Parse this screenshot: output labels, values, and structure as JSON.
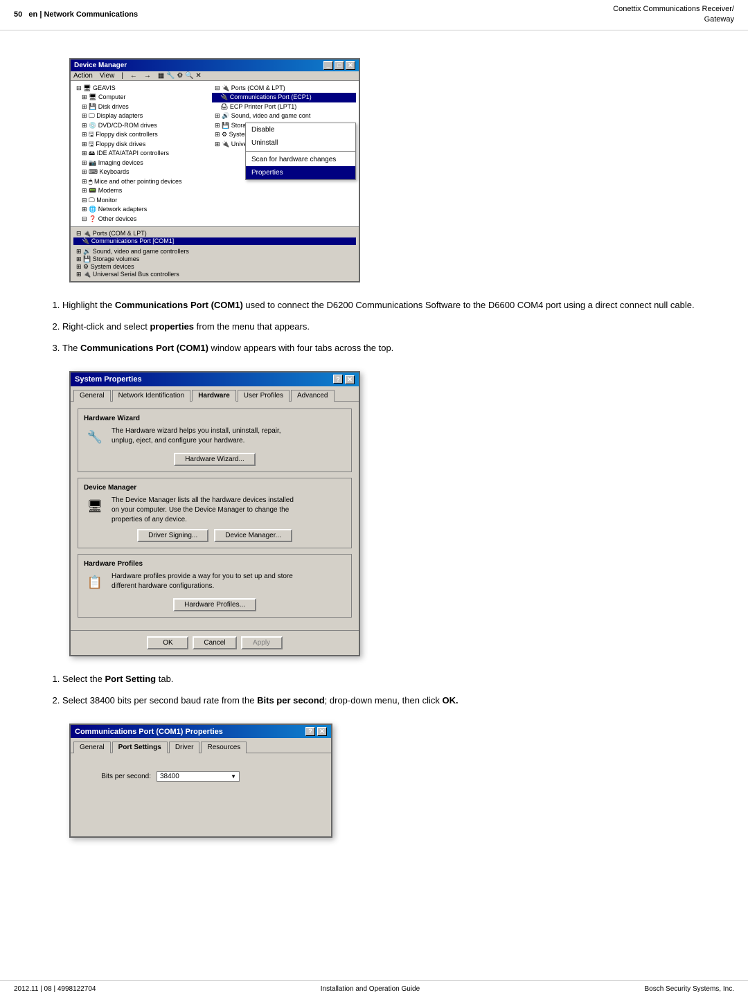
{
  "header": {
    "page_num": "50",
    "section": "en | Network Communications",
    "product": "Conettix Communications Receiver/",
    "product2": "Gateway"
  },
  "footer": {
    "left": "2012.11 | 08 | 4998122704",
    "center": "Installation and Operation Guide",
    "right": "Bosch Security Systems, Inc."
  },
  "device_manager": {
    "title": "Device Manager",
    "menu_items": [
      "Action",
      "View"
    ],
    "tree_root": "GEAVIS",
    "tree_items": [
      "Computer",
      "Disk drives",
      "Display adapters",
      "DVD/CD-ROM drives",
      "Floppy disk controllers",
      "Floppy disk drives",
      "IDE ATA/ATAPI controllers",
      "Imaging devices",
      "Keyboards",
      "Mice and other pointing devices",
      "Modems",
      "Monitor",
      "Network adapters",
      "Other devices",
      "Ports (COM & LPT)",
      "Communications Port (ECP1)",
      "ECP Printer Port (LPT1)",
      "Sound, video and game cont",
      "Storage volumes",
      "System devices",
      "Universal Serial Bus contro"
    ],
    "context_menu": [
      "Disable",
      "Uninstall",
      "Scan for hardware changes",
      "Properties"
    ],
    "selected_menu": "Properties",
    "ports_section": "Ports (COM & LPT)",
    "port_highlight": "Communications Port [COM1]"
  },
  "instructions1": [
    {
      "num": "1",
      "text_normal": "Highlight the ",
      "text_bold": "Communications Port (COM1)",
      "text_after": " used to connect the D6200 Communications Software to the D6600 COM4 port using a direct connect null cable."
    },
    {
      "num": "2",
      "text_normal": "Right-click and select ",
      "text_bold": "properties",
      "text_after": " from the menu that appears."
    },
    {
      "num": "3",
      "text_normal": "The ",
      "text_bold": "Communications Port (COM1)",
      "text_after": " window appears with four tabs across the top."
    }
  ],
  "system_props": {
    "title": "System Properties",
    "tabs": [
      "General",
      "Network Identification",
      "Hardware",
      "User Profiles",
      "Advanced"
    ],
    "active_tab": "Hardware",
    "sections": [
      {
        "name": "Hardware Wizard",
        "text": "The Hardware wizard helps you install, uninstall, repair, unplug, eject, and configure your hardware.",
        "button": "Hardware Wizard..."
      },
      {
        "name": "Device Manager",
        "text": "The Device Manager lists all the hardware devices installed on your computer. Use the Device Manager to change the properties of any device.",
        "buttons": [
          "Driver Signing...",
          "Device Manager..."
        ]
      },
      {
        "name": "Hardware Profiles",
        "text": "Hardware profiles provide a way for you to set up and store different hardware configurations.",
        "button": "Hardware Profiles..."
      }
    ],
    "footer_buttons": [
      "OK",
      "Cancel",
      "Apply"
    ]
  },
  "instructions2": [
    {
      "num": "1",
      "text_normal": "Select the ",
      "text_bold": "Port Setting",
      "text_after": " tab."
    },
    {
      "num": "2",
      "text_normal": "Select 38400 bits per second baud rate from the ",
      "text_bold": "Bits per second",
      "text_after": "; drop-down menu, then click ",
      "text_bold2": "OK."
    }
  ],
  "com_props": {
    "title": "Communications Port (COM1) Properties",
    "tabs": [
      "General",
      "Port Settings",
      "Driver",
      "Resources"
    ],
    "active_tab": "Port Settings",
    "field_label": "Bits per second:",
    "field_value": "38400"
  }
}
